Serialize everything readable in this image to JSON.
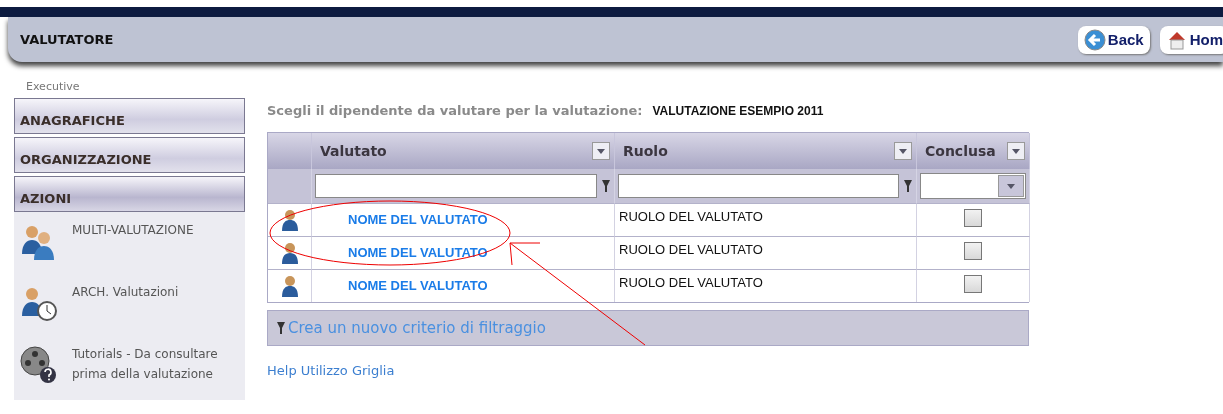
{
  "header": {
    "title": "VALUTATORE",
    "buttons": [
      {
        "kind": "back",
        "label": "Back"
      },
      {
        "kind": "home",
        "label": "Hom"
      }
    ]
  },
  "breadcrumb": "Executive",
  "sidebar": {
    "sections": [
      {
        "label": "ANAGRAFICHE",
        "expanded": false
      },
      {
        "label": "ORGANIZZAZIONE",
        "expanded": false
      },
      {
        "label": "AZIONI",
        "expanded": true
      }
    ],
    "items": [
      {
        "kind": "group",
        "label": "MULTI-VALUTAZIONE"
      },
      {
        "kind": "archive",
        "label": "ARCH. Valutazioni"
      },
      {
        "kind": "video",
        "label": "Tutorials - Da consultare prima della valutazione"
      }
    ]
  },
  "prompt": {
    "label": "Scegli il dipendente da valutare per la valutazione:",
    "value": "VALUTAZIONE ESEMPIO 2011"
  },
  "table": {
    "columns": [
      {
        "label": "Valutato",
        "kind": "text"
      },
      {
        "label": "Ruolo",
        "kind": "text"
      },
      {
        "label": "Conclusa",
        "kind": "select"
      }
    ],
    "rows": [
      {
        "name": "NOME DEL VALUTATO",
        "role": "RUOLO DEL VALUTATO",
        "concluded": false
      },
      {
        "name": "NOME DEL VALUTATO",
        "role": "RUOLO DEL VALUTATO",
        "concluded": false
      },
      {
        "name": "NOME DEL VALUTATO",
        "role": "RUOLO DEL VALUTATO",
        "concluded": false
      }
    ],
    "footer": "Crea un nuovo criterio di filtraggio"
  },
  "help_link": "Help Utilizzo Griglia"
}
